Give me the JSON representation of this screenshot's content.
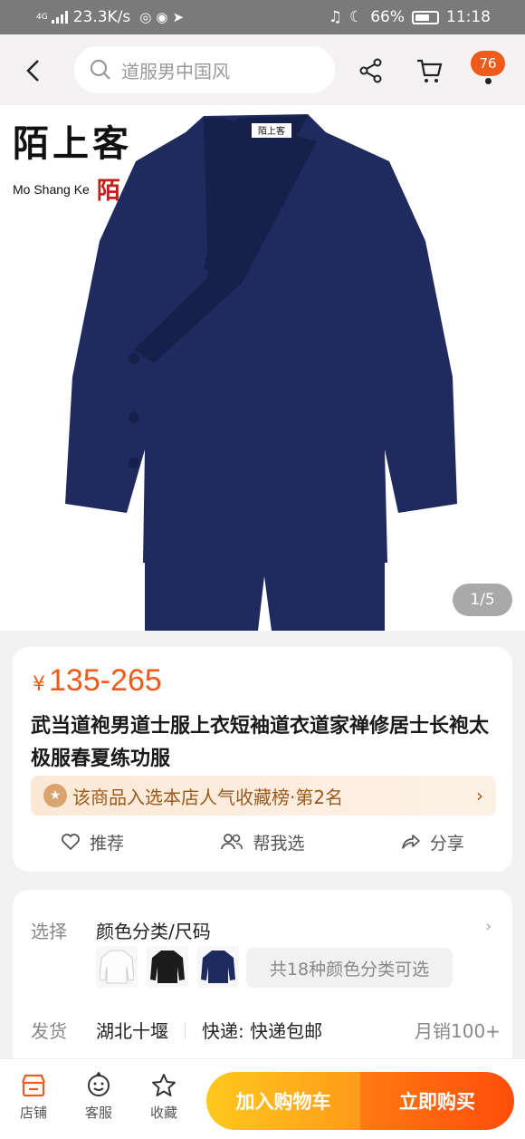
{
  "status_bar": {
    "network": "4G",
    "speed": "23.3K/s",
    "battery": "66%",
    "battery_level": 0.66,
    "time": "11:18"
  },
  "header": {
    "search_placeholder": "道服男中国风",
    "cart_badge": "76"
  },
  "gallery": {
    "brand_cn": "陌上客",
    "brand_en": "Mo Shang Ke",
    "brand_seal": "陌",
    "counter": "1/5",
    "colors": {
      "garment": "#1f2a5e",
      "garment_shadow": "#17204a"
    }
  },
  "product": {
    "currency": "¥",
    "price": "135-265",
    "title": "武当道袍男道士服上衣短袖道衣道家禅修居士长袍太极服春夏练功服",
    "rank_text": "该商品入选本店人气收藏榜·第2名",
    "actions": [
      {
        "label": "推荐",
        "icon": "heart-icon"
      },
      {
        "label": "帮我选",
        "icon": "people-icon"
      },
      {
        "label": "分享",
        "icon": "share-arrow-icon"
      }
    ]
  },
  "spec": {
    "select_label": "选择",
    "select_value": "颜色分类/尺码",
    "more_colors": "共18种颜色分类可选",
    "ship_label": "发货",
    "ship_from": "湖北十堰",
    "delivery": "快递: 快递包邮",
    "sales": "月销100+"
  },
  "bottom": {
    "store": "店铺",
    "service": "客服",
    "favorite": "收藏",
    "add_cart": "加入购物车",
    "buy_now": "立即购买"
  },
  "accent": "#f05a1a"
}
